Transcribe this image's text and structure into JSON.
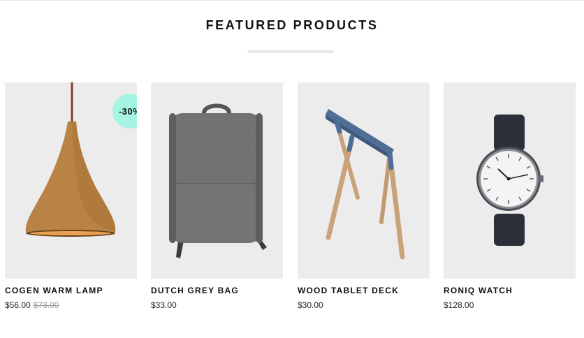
{
  "section": {
    "title": "FEATURED PRODUCTS"
  },
  "products": [
    {
      "name": "COGEN WARM LAMP",
      "price": "$56.00",
      "old_price": "$73.00",
      "badge": "-30%",
      "icon": "pendant-lamp-image"
    },
    {
      "name": "DUTCH GREY BAG",
      "price": "$33.00",
      "icon": "backpack-image"
    },
    {
      "name": "WOOD TABLET DECK",
      "price": "$30.00",
      "icon": "trestle-stand-image"
    },
    {
      "name": "RONIQ WATCH",
      "price": "$128.00",
      "icon": "wristwatch-image"
    }
  ],
  "colors": {
    "card_background": "#ececec",
    "badge": "#a6f5e2",
    "old_price": "#9a9a9a",
    "heading": "#111111"
  }
}
